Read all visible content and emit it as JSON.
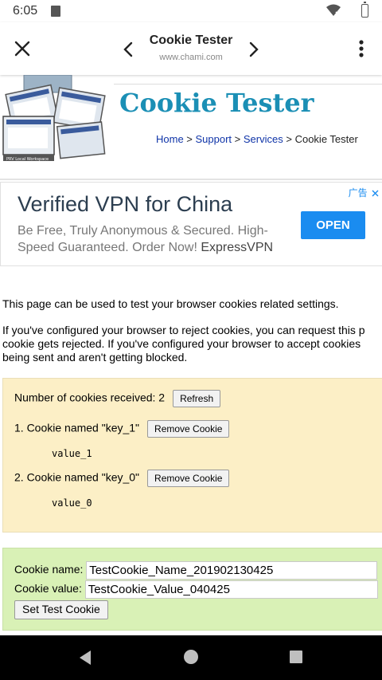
{
  "status_bar": {
    "time": "6:05"
  },
  "toolbar": {
    "title": "Cookie Tester",
    "url": "www.chami.com"
  },
  "site": {
    "title": "Cookie Tester",
    "breadcrumb": {
      "home": "Home",
      "support": "Support",
      "services": "Services",
      "current": "Cookie Tester",
      "separator": " > "
    },
    "logo_caption": "PRV Local Workspace"
  },
  "ad": {
    "title": "Verified VPN for China",
    "body": "Be Free, Truly Anonymous & Secured. High-Speed Guaranteed. Order Now!",
    "brand": "ExpressVPN",
    "open_label": "OPEN",
    "badge": "广告"
  },
  "content": {
    "p1": "This page can be used to test your browser cookies related settings.",
    "p2_line1": "If you've configured your browser to reject cookies, you can request this p",
    "p2_line2": "cookie gets rejected. If you've configured your browser to accept cookies",
    "p2_line3": "being sent and aren't getting blocked."
  },
  "cookies": {
    "count_label": "Number of cookies received: 2",
    "refresh_label": "Refresh",
    "items": [
      {
        "label": "1. Cookie named \"key_1\"",
        "value": "value_1",
        "remove_label": "Remove Cookie"
      },
      {
        "label": "2. Cookie named \"key_0\"",
        "value": "value_0",
        "remove_label": "Remove Cookie"
      }
    ]
  },
  "set_cookie": {
    "name_label": "Cookie name:",
    "name_value": "TestCookie_Name_201902130425",
    "value_label": "Cookie value:",
    "value_value": "TestCookie_Value_040425",
    "button_label": "Set Test Cookie"
  },
  "colors": {
    "site_title": "#1b8fb5",
    "link": "#0f34a8",
    "ad_button": "#1a8cf0",
    "cookie_box": "#fcefc6",
    "set_box": "#d9f1b6"
  }
}
